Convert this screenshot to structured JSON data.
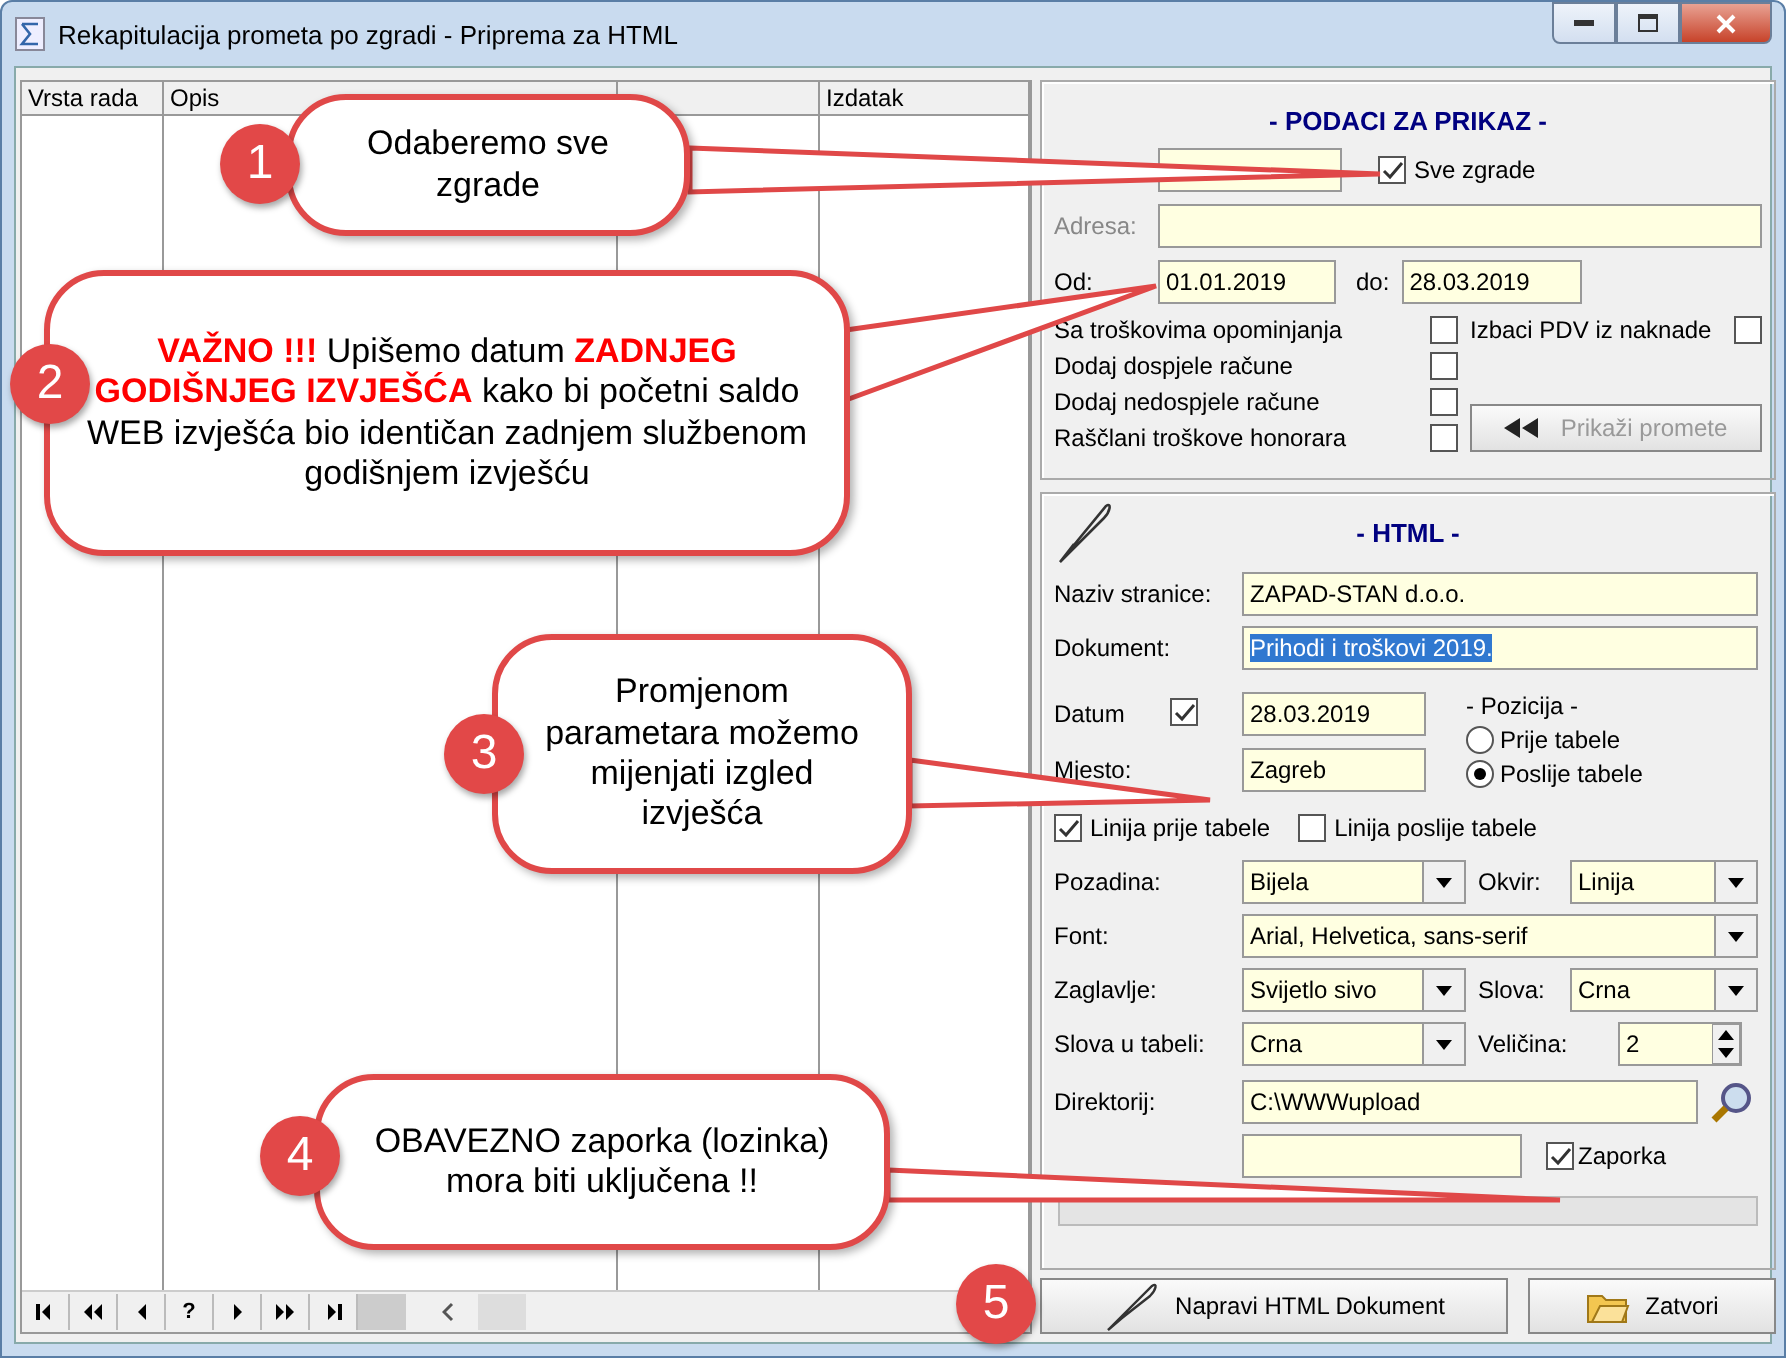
{
  "window": {
    "title": "Rekapitulacija prometa po zgradi - Priprema za HTML"
  },
  "grid": {
    "columns": [
      "Vrsta rada",
      "Opis",
      null,
      "Izdatak"
    ],
    "navigator": [
      {
        "kind": "first"
      },
      {
        "kind": "prior_page"
      },
      {
        "kind": "prior"
      },
      {
        "kind": "help",
        "label": "?"
      },
      {
        "kind": "next"
      },
      {
        "kind": "next_page"
      },
      {
        "kind": "last"
      }
    ]
  },
  "podaci": {
    "title": "- PODACI ZA PRIKAZ -",
    "all_buildings": {
      "label": "Sve zgrade",
      "checked": true
    },
    "adresa": {
      "label": "Adresa:"
    },
    "od": {
      "label": "Od:",
      "value": "01.01.2019"
    },
    "do": {
      "label": "do:",
      "value": "28.03.2019"
    },
    "options": [
      {
        "label": "Sa troškovima opominjanja",
        "checked": false
      },
      {
        "label": "Dodaj dospjele račune",
        "checked": false
      },
      {
        "label": "Dodaj nedospjele račune",
        "checked": false
      },
      {
        "label": "Raščlani troškove honorara",
        "checked": false
      }
    ],
    "izbaci_pdv": {
      "label": "Izbaci PDV iz naknade",
      "checked": false
    },
    "show_button": {
      "label": "Prikaži promete",
      "disabled": true
    }
  },
  "html": {
    "title": "- HTML -",
    "naziv": {
      "label": "Naziv stranice:",
      "value": "ZAPAD-STAN d.o.o."
    },
    "dokument": {
      "label": "Dokument:",
      "value": "Prihodi i troškovi 2019.",
      "selected": true
    },
    "datum": {
      "label": "Datum",
      "checked": true,
      "value": "28.03.2019"
    },
    "mjesto": {
      "label": "Mjesto:",
      "value": "Zagreb"
    },
    "pozicija": {
      "title": "- Pozicija -",
      "options": [
        {
          "label": "Prije tabele",
          "selected": false
        },
        {
          "label": "Poslije tabele",
          "selected": true
        }
      ]
    },
    "lines": [
      {
        "label": "Linija prije tabele",
        "checked": true
      },
      {
        "label": "Linija poslije tabele",
        "checked": false
      }
    ],
    "pozadina": {
      "label": "Pozadina:",
      "value": "Bijela"
    },
    "okvir": {
      "label": "Okvir:",
      "value": "Linija"
    },
    "font": {
      "label": "Font:",
      "value": "Arial, Helvetica, sans-serif"
    },
    "zaglavlje": {
      "label": "Zaglavlje:",
      "value": "Svijetlo sivo"
    },
    "slova": {
      "label": "Slova:",
      "value": "Crna"
    },
    "slova_u_tabeli": {
      "label": "Slova u tabeli:",
      "value": "Crna"
    },
    "velicina": {
      "label": "Veličina:",
      "value": "2"
    },
    "direktorij": {
      "label": "Direktorij:",
      "value": "C:\\WWWupload"
    },
    "zaporka": {
      "label": "Zaporka",
      "checked": true
    }
  },
  "buttons": [
    {
      "kind": "create",
      "label": "Napravi HTML Dokument"
    },
    {
      "kind": "close",
      "label": "Zatvori"
    }
  ],
  "callouts": [
    {
      "number": "1",
      "text": "Odaberemo sve zgrade"
    },
    {
      "number": "2",
      "text": "**VAŽNO !!!** Upišemo datum **ZADNJEG GODIŠNJEG IZVJEŠĆA** kako bi početni saldo WEB izvješća bio identičan zadnjem službenom godišnjem izvješću"
    },
    {
      "number": "3",
      "text": "Promjenom parametara možemo mijenjati izgled izvješća"
    },
    {
      "number": "4",
      "text": "OBAVEZNO zaporka (lozinka) mora biti uključena !!"
    },
    {
      "number": "5"
    }
  ]
}
